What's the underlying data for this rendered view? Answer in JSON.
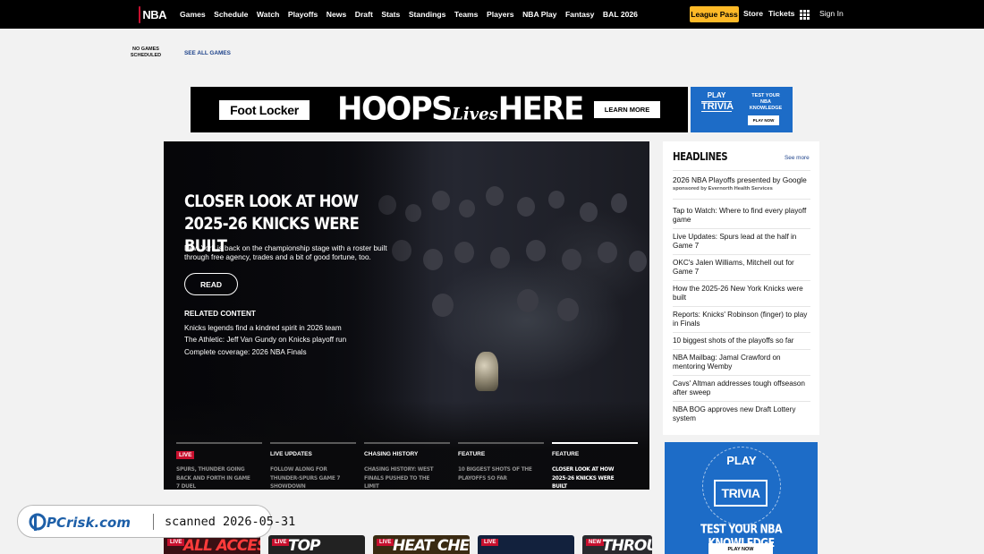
{
  "nav": {
    "logo_text": "NBA",
    "links": [
      "Games",
      "Schedule",
      "Watch",
      "Playoffs",
      "News",
      "Draft",
      "Stats",
      "Standings",
      "Teams",
      "Players",
      "NBA Play",
      "Fantasy",
      "BAL 2026"
    ],
    "league_pass": "League Pass",
    "store": "Store",
    "tickets": "Tickets",
    "sign_in": "Sign In"
  },
  "scores": {
    "no_games": "NO GAMES SCHEDULED",
    "see_all": "SEE ALL GAMES"
  },
  "ad_banner": {
    "brand": "Foot Locker",
    "headline_a": "HOOPS",
    "headline_b": "Lives",
    "headline_c": "HERE",
    "cta": "LEARN MORE"
  },
  "trivia_small": {
    "logo_top": "PLAY",
    "logo_main": "TRIVIA",
    "text": "TEST YOUR NBA KNOWLEDGE",
    "cta": "PLAY NOW"
  },
  "hero": {
    "title": "CLOSER LOOK AT HOW 2025-26 KNICKS WERE BUILT",
    "description": "New York is back on the championship stage with a roster built through free agency, trades and a bit of good fortune, too.",
    "read_label": "READ",
    "related_label": "RELATED CONTENT",
    "related": [
      "Knicks legends find a kindred spirit in 2026 team",
      "The Athletic: Jeff Van Gundy on Knicks playoff run",
      "Complete coverage: 2026 NBA Finals"
    ],
    "tabs": [
      {
        "tag": "LIVE",
        "title": "SPURS, THUNDER GOING BACK AND FORTH IN GAME 7 DUEL",
        "live": true,
        "active": false
      },
      {
        "tag": "LIVE UPDATES",
        "title": "FOLLOW ALONG FOR THUNDER-SPURS GAME 7 SHOWDOWN",
        "live": false,
        "active": false
      },
      {
        "tag": "CHASING HISTORY",
        "title": "CHASING HISTORY: WEST FINALS PUSHED TO THE LIMIT",
        "live": false,
        "active": false
      },
      {
        "tag": "FEATURE",
        "title": "10 BIGGEST SHOTS OF THE PLAYOFFS SO FAR",
        "live": false,
        "active": false
      },
      {
        "tag": "FEATURE",
        "title": "CLOSER LOOK AT HOW 2025-26 KNICKS WERE BUILT",
        "live": false,
        "active": true
      }
    ]
  },
  "headlines": {
    "title": "HEADLINES",
    "see_more": "See more",
    "sponsor_title": "2026 NBA Playoffs presented by Google",
    "sponsor_sub": "sponsored by Evernorth Health Services",
    "items": [
      "Tap to Watch: Where to find every playoff game",
      "Live Updates: Spurs lead at the half in Game 7",
      "OKC's Jalen Williams, Mitchell out for Game 7",
      "How the 2025-26 New York Knicks were built",
      "Reports: Knicks' Robinson (finger) to play in Finals",
      "10 biggest shots of the playoffs so far",
      "NBA Mailbag: Jamal Crawford on mentoring Wemby",
      "Cavs' Altman addresses tough offseason after sweep",
      "NBA BOG approves new Draft Lottery system"
    ]
  },
  "trivia_big": {
    "logo_top": "PLAY",
    "logo_main": "TRIVIA",
    "text": "TEST YOUR NBA KNOWLEDGE",
    "cta": "PLAY NOW"
  },
  "watermark": {
    "logo": "PCrisk.com",
    "scanned": "scanned 2026-05-31"
  },
  "video_cards": [
    {
      "badge": "LIVE",
      "word": "ALL ACCESS"
    },
    {
      "badge": "LIVE",
      "word": "TOP"
    },
    {
      "badge": "LIVE",
      "word": "HEAT CHECK"
    },
    {
      "badge": "LIVE",
      "word": ""
    },
    {
      "badge": "NEW",
      "word": "THROUGH"
    }
  ],
  "colors": {
    "nav_bg": "#000000",
    "league_pass_bg": "#fdb927",
    "nba_blue": "#1d428a",
    "nba_red": "#c8102e",
    "trivia_blue": "#1d6cc7"
  }
}
